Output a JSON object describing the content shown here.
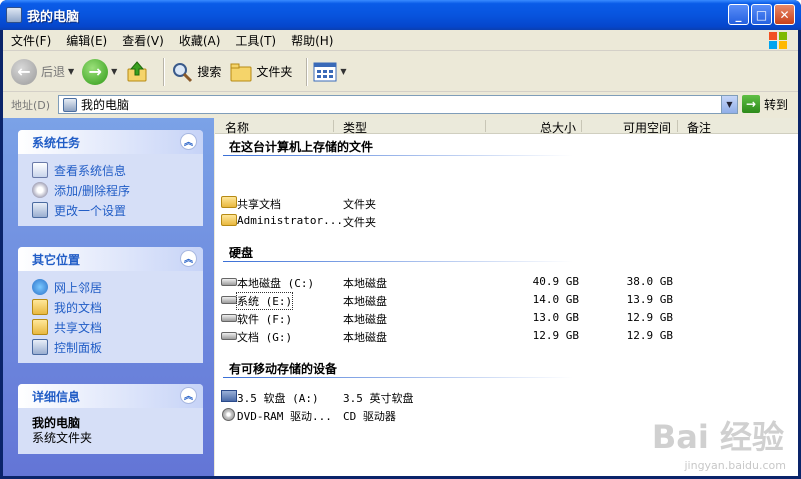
{
  "window": {
    "title": "我的电脑"
  },
  "titlebar_buttons": {
    "minimize": "_",
    "maximize": "□",
    "close": "✕"
  },
  "menu": [
    "文件(F)",
    "编辑(E)",
    "查看(V)",
    "收藏(A)",
    "工具(T)",
    "帮助(H)"
  ],
  "toolbar": {
    "back": "后退",
    "search": "搜索",
    "folders": "文件夹"
  },
  "address": {
    "label": "地址(D)",
    "value": "我的电脑",
    "go": "转到"
  },
  "tasks": {
    "system": {
      "title": "系统任务",
      "items": [
        "查看系统信息",
        "添加/删除程序",
        "更改一个设置"
      ]
    },
    "places": {
      "title": "其它位置",
      "items": [
        "网上邻居",
        "我的文档",
        "共享文档",
        "控制面板"
      ]
    },
    "details": {
      "title": "详细信息",
      "name": "我的电脑",
      "desc": "系统文件夹"
    }
  },
  "columns": [
    "名称",
    "类型",
    "总大小",
    "可用空间",
    "备注"
  ],
  "groups": {
    "stored": {
      "title": "在这台计算机上存储的文件",
      "items": [
        {
          "name": "共享文档",
          "type": "文件夹"
        },
        {
          "name": "Administrator...",
          "type": "文件夹"
        }
      ]
    },
    "hdd": {
      "title": "硬盘",
      "items": [
        {
          "name": "本地磁盘 (C:)",
          "type": "本地磁盘",
          "total": "40.9 GB",
          "free": "38.0 GB"
        },
        {
          "name": "系统 (E:)",
          "type": "本地磁盘",
          "total": "14.0 GB",
          "free": "13.9 GB"
        },
        {
          "name": "软件 (F:)",
          "type": "本地磁盘",
          "total": "13.0 GB",
          "free": "12.9 GB"
        },
        {
          "name": "文档 (G:)",
          "type": "本地磁盘",
          "total": "12.9 GB",
          "free": "12.9 GB"
        }
      ]
    },
    "removable": {
      "title": "有可移动存储的设备",
      "items": [
        {
          "name": "3.5 软盘 (A:)",
          "type": "3.5 英寸软盘"
        },
        {
          "name": "DVD-RAM 驱动...",
          "type": "CD 驱动器"
        }
      ]
    }
  },
  "watermark": {
    "logo": "Bai 经验",
    "url": "jingyan.baidu.com"
  }
}
